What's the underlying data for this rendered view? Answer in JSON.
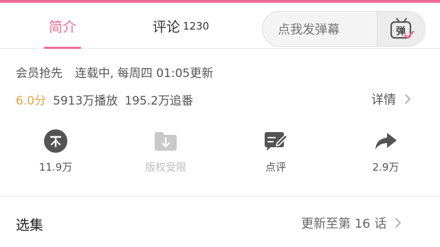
{
  "tabs": {
    "intro_label": "简介",
    "comments_label": "评论",
    "comments_count": "1230",
    "active_color": "#f06b94"
  },
  "danmaku": {
    "placeholder": "点我发弹幕",
    "button_char": "弹",
    "button_icon": "danmaku-tv-icon"
  },
  "info": {
    "vip_first": "会员抢先",
    "status": "连载中, 每周四 01:05更新",
    "score": "6.0分",
    "plays": "5913万播放",
    "follows": "195.2万追番",
    "details_label": "详情",
    "score_color": "#e8a24a"
  },
  "actions": [
    {
      "icon": "coin-icon",
      "label": "11.9万",
      "enabled": true
    },
    {
      "icon": "copyright-download-icon",
      "label": "版权受限",
      "enabled": false
    },
    {
      "icon": "review-icon",
      "label": "点评",
      "enabled": true
    },
    {
      "icon": "share-icon",
      "label": "2.9万",
      "enabled": true
    }
  ],
  "episodes": {
    "title": "选集",
    "update_label": "更新至第 16 话"
  }
}
